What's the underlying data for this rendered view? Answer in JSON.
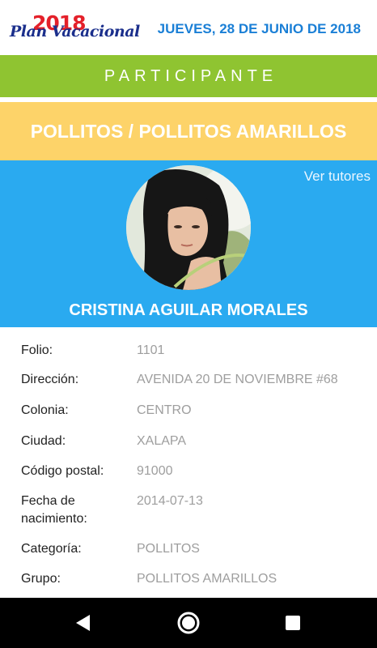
{
  "header": {
    "logo_year": "2018",
    "logo_script": "Plan Vacacional",
    "date": "JUEVES, 28 DE JUNIO DE 2018"
  },
  "role_banner": "PARTICIPANTE",
  "group_banner": "POLLITOS / POLLITOS AMARILLOS",
  "profile": {
    "tutors_link": "Ver tutores",
    "name": "CRISTINA AGUILAR MORALES"
  },
  "details": [
    {
      "label": "Folio:",
      "value": "1101"
    },
    {
      "label": "Dirección:",
      "value": "AVENIDA 20 DE NOVIEMBRE #68"
    },
    {
      "label": "Colonia:",
      "value": "CENTRO"
    },
    {
      "label": "Ciudad:",
      "value": "XALAPA"
    },
    {
      "label": "Código postal:",
      "value": "91000"
    },
    {
      "label": "Fecha de nacimiento:",
      "value": "2014-07-13"
    },
    {
      "label": "Categoría:",
      "value": "POLLITOS"
    },
    {
      "label": "Grupo:",
      "value": "POLLITOS AMARILLOS"
    }
  ],
  "navigation": {
    "back": "back-icon",
    "home": "home-icon",
    "recents": "recents-icon"
  },
  "colors": {
    "role_bar": "#8fc431",
    "group_bar": "#fdd369",
    "profile_bg": "#2aaaf0",
    "date_text": "#1a7fd6"
  }
}
